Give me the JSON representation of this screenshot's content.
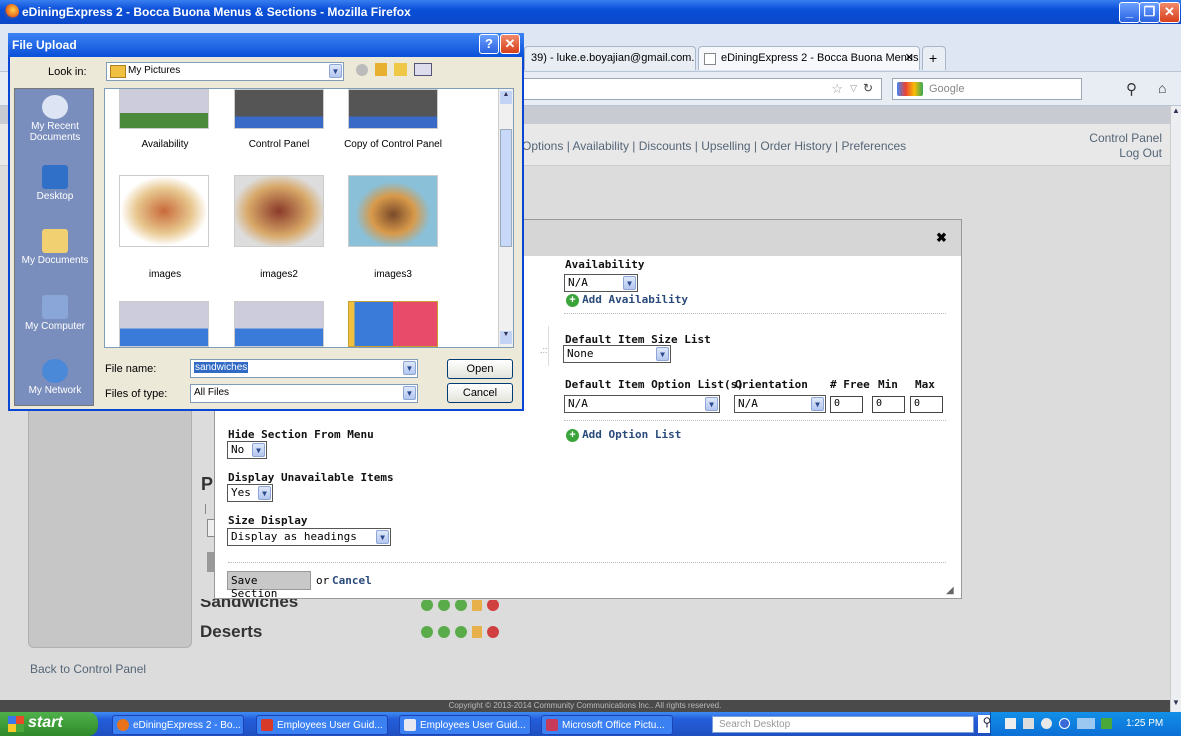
{
  "window": {
    "title": "eDiningExpress 2 - Bocca Buona Menus & Sections - Mozilla Firefox"
  },
  "browser": {
    "tabs": [
      {
        "label": "39) - luke.e.boyajian@gmail.com..."
      },
      {
        "label": "eDiningExpress 2 - Bocca Buona Menus &..."
      }
    ],
    "search_placeholder": "Google"
  },
  "page": {
    "nav_links": "Options | Availability | Discounts | Upselling | Order History | Preferences",
    "control_panel": "Control Panel",
    "log_out": "Log Out",
    "back_link": "Back to Control Panel",
    "footer": "Copyright © 2013-2014 Community Communications Inc.. All rights reserved.",
    "partial_letter": "P",
    "sections": [
      "Sandwiches",
      "Deserts"
    ]
  },
  "section_form": {
    "availability_label": "Availability",
    "availability_value": "N/A",
    "add_availability": "Add Availability",
    "size_list_label": "Default Item Size List",
    "size_list_value": "None",
    "option_list_label": "Default Item Option List(s)",
    "orientation_label": "Orientation",
    "free_label": "# Free",
    "min_label": "Min",
    "max_label": "Max",
    "option_list_value": "N/A",
    "orientation_value": "N/A",
    "free_value": "0",
    "min_value": "0",
    "max_value": "0",
    "add_option_list": "Add Option List",
    "hide_label": "Hide Section From Menu",
    "hide_value": "No",
    "unavailable_label": "Display Unavailable Items",
    "unavailable_value": "Yes",
    "size_display_label": "Size Display",
    "size_display_value": "Display as headings",
    "save_button": "Save Section",
    "or_text": "or",
    "cancel_link": "Cancel"
  },
  "file_upload": {
    "title": "File Upload",
    "look_in_label": "Look in:",
    "look_in_value": "My Pictures",
    "places": [
      "My Recent Documents",
      "Desktop",
      "My Documents",
      "My Computer",
      "My Network"
    ],
    "files": [
      "Availability",
      "Control Panel",
      "Copy of Control Panel",
      "images",
      "images2",
      "images3"
    ],
    "file_name_label": "File name:",
    "file_name_value": "sandwiches",
    "files_of_type_label": "Files of type:",
    "files_of_type_value": "All Files",
    "open_button": "Open",
    "cancel_button": "Cancel"
  },
  "taskbar": {
    "start": "start",
    "tasks": [
      "eDiningExpress 2 - Bo...",
      "Employees User Guid...",
      "Employees User Guid...",
      "Microsoft Office Pictu..."
    ],
    "search_placeholder": "Search Desktop",
    "time": "1:25 PM"
  }
}
